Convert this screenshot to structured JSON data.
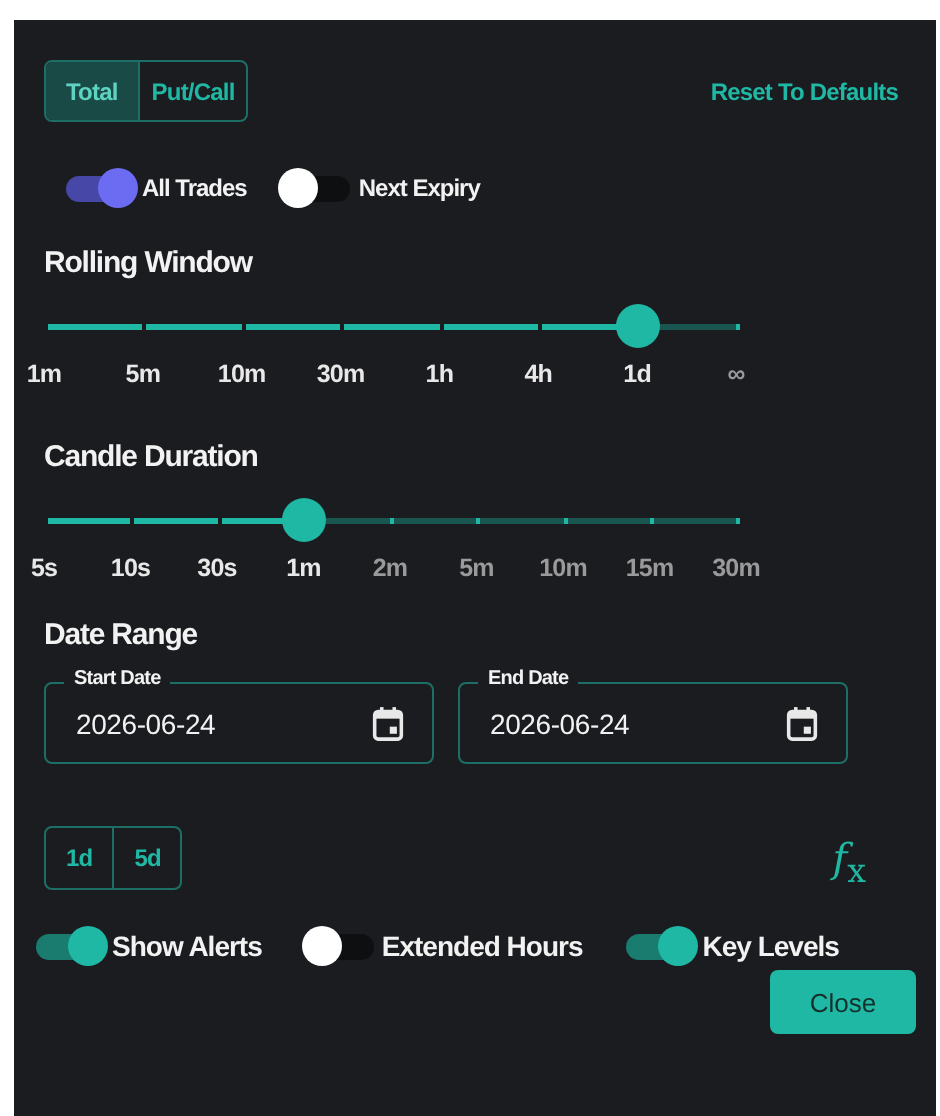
{
  "view_tabs": [
    {
      "label": "Total",
      "selected": true
    },
    {
      "label": "Put/Call",
      "selected": false
    }
  ],
  "reset_link": "Reset To Defaults",
  "trade_toggles": [
    {
      "label": "All Trades",
      "on": true
    },
    {
      "label": "Next Expiry",
      "on": false
    }
  ],
  "sliders": [
    {
      "title": "Rolling Window",
      "ticks": [
        "1m",
        "5m",
        "10m",
        "30m",
        "1h",
        "4h",
        "1d",
        "∞"
      ],
      "level": 0.857
    },
    {
      "title": "Candle Duration",
      "ticks": [
        "5s",
        "10s",
        "30s",
        "1m",
        "2m",
        "5m",
        "10m",
        "15m",
        "30m"
      ],
      "level": 0.375
    }
  ],
  "date_range": {
    "title": "Date Range",
    "fields": [
      {
        "label": "Start Date",
        "value": "2026-06-24"
      },
      {
        "label": "End Date",
        "value": "2026-06-24"
      }
    ]
  },
  "range_buttons": [
    "1d",
    "5d"
  ],
  "formula_button": "*f*$_{x}$",
  "option_toggles": [
    {
      "label": "Show Alerts",
      "on": true
    },
    {
      "label": "Extended Hours",
      "on": false
    },
    {
      "label": "Key Levels",
      "on": true
    }
  ],
  "close_button": "Close"
}
